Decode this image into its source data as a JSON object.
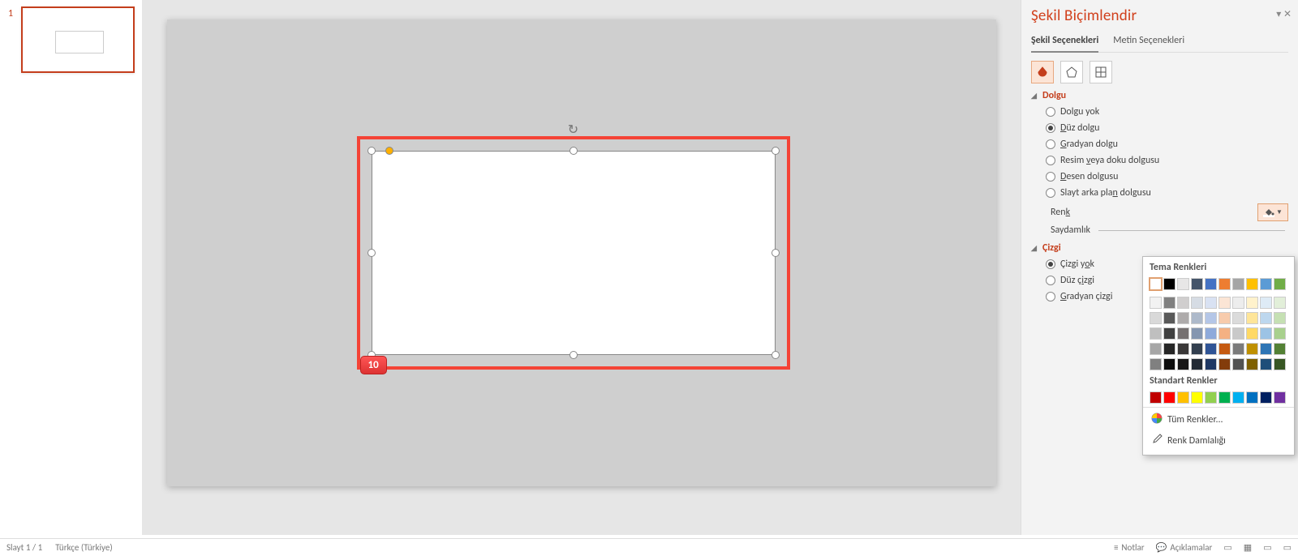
{
  "thumbnail": {
    "number": "1"
  },
  "shape_badge": "10",
  "panel": {
    "title": "Şekil Biçimlendir",
    "tabs": {
      "shape": "Şekil Seçenekleri",
      "text": "Metin Seçenekleri"
    },
    "fill": {
      "header": "Dolgu",
      "options": {
        "none": "Dolgu yok",
        "solid": "Düz dolgu",
        "gradient": "Gradyan dolgu",
        "picture": "Resim veya doku dolgusu",
        "pattern": "Desen dolgusu",
        "slidebg": "Slayt arka plan dolgusu"
      },
      "selected": "solid",
      "color_label": "Renk",
      "transparency_label": "Saydamlık"
    },
    "line": {
      "header": "Çizgi",
      "options": {
        "none": "Çizgi yok",
        "solid": "Düz çizgi",
        "gradient": "Gradyan çizgi"
      },
      "selected": "none"
    }
  },
  "color_popup": {
    "theme_title": "Tema Renkleri",
    "theme_row": [
      "#ffffff",
      "#000000",
      "#e7e6e6",
      "#44546a",
      "#4472c4",
      "#ed7d31",
      "#a5a5a5",
      "#ffc000",
      "#5b9bd5",
      "#70ad47"
    ],
    "theme_tints": [
      [
        "#f2f2f2",
        "#808080",
        "#d0cece",
        "#d6dce4",
        "#d9e2f3",
        "#fbe5d5",
        "#ededed",
        "#fff2cc",
        "#deebf6",
        "#e2efd9"
      ],
      [
        "#d9d9d9",
        "#595959",
        "#aeabab",
        "#adb9ca",
        "#b4c6e7",
        "#f7cbac",
        "#dbdbdb",
        "#fee599",
        "#bdd7ee",
        "#c5e0b3"
      ],
      [
        "#bfbfbf",
        "#404040",
        "#757070",
        "#8496b0",
        "#8eaadb",
        "#f4b183",
        "#c9c9c9",
        "#ffd965",
        "#9cc3e5",
        "#a8d08d"
      ],
      [
        "#a6a6a6",
        "#262626",
        "#3a3838",
        "#323f4f",
        "#2f5496",
        "#c55a11",
        "#7b7b7b",
        "#bf9000",
        "#2e75b5",
        "#538135"
      ],
      [
        "#808080",
        "#0d0d0d",
        "#171616",
        "#222a35",
        "#1f3864",
        "#833c0b",
        "#525252",
        "#7f6000",
        "#1e4e79",
        "#375623"
      ]
    ],
    "standard_title": "Standart Renkler",
    "standard_row": [
      "#c00000",
      "#ff0000",
      "#ffc000",
      "#ffff00",
      "#92d050",
      "#00b050",
      "#00b0f0",
      "#0070c0",
      "#002060",
      "#7030a0"
    ],
    "more_colors": "Tüm Renkler...",
    "eyedropper": "Renk Damlalığı"
  },
  "status": {
    "slide": "Slayt 1 / 1",
    "lang": "Türkçe (Türkiye)",
    "notes": "Notlar",
    "comments": "Açıklamalar"
  }
}
